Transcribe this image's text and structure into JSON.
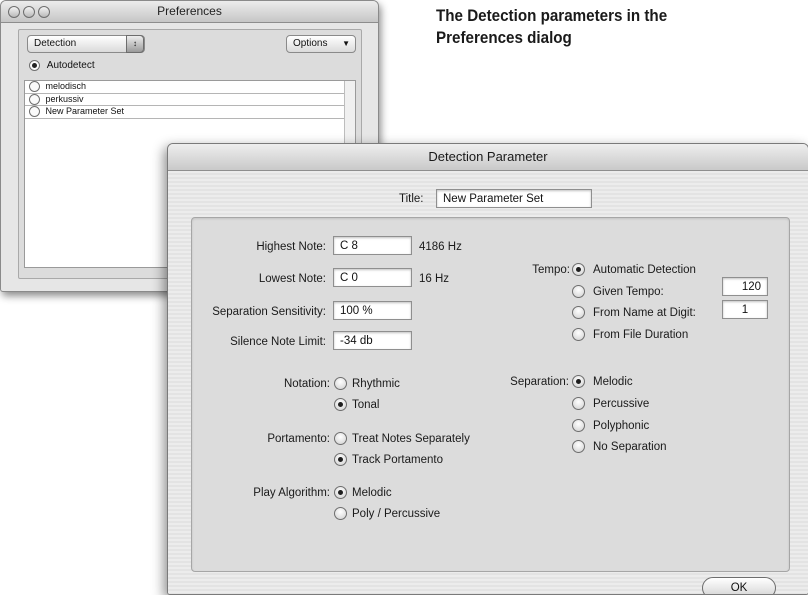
{
  "caption": {
    "line1": "The Detection parameters in the",
    "line2": "Preferences dialog"
  },
  "prefs_window": {
    "title": "Preferences",
    "category_popup": "Detection",
    "options_popup": "Options",
    "autodetect_label": "Autodetect",
    "parameter_sets": [
      "melodisch",
      "perkussiv",
      "New Parameter Set"
    ]
  },
  "dialog": {
    "title": "Detection Parameter",
    "title_field_label": "Title:",
    "title_field_value": "New Parameter Set",
    "highest_note": {
      "label": "Highest Note:",
      "value": "C 8",
      "hz": "4186 Hz"
    },
    "lowest_note": {
      "label": "Lowest Note:",
      "value": "C 0",
      "hz": "16 Hz"
    },
    "separation_sensitivity": {
      "label": "Separation Sensitivity:",
      "value": "100 %"
    },
    "silence_note_limit": {
      "label": "Silence Note Limit:",
      "value": "-34 db"
    },
    "tempo": {
      "label": "Tempo:",
      "options": [
        "Automatic Detection",
        "Given Tempo:",
        "From Name at Digit:",
        "From File Duration"
      ],
      "selected": "Automatic Detection",
      "given_tempo_value": "120",
      "digit_value": "1"
    },
    "notation": {
      "label": "Notation:",
      "options": [
        "Rhythmic",
        "Tonal"
      ],
      "selected": "Tonal"
    },
    "separation": {
      "label": "Separation:",
      "options": [
        "Melodic",
        "Percussive",
        "Polyphonic",
        "No Separation"
      ],
      "selected": "Melodic"
    },
    "portamento": {
      "label": "Portamento:",
      "options": [
        "Treat Notes Separately",
        "Track Portamento"
      ],
      "selected": "Track Portamento"
    },
    "play_algorithm": {
      "label": "Play Algorithm:",
      "options": [
        "Melodic",
        "Poly / Percussive"
      ],
      "selected": "Melodic"
    },
    "ok_label": "OK"
  }
}
